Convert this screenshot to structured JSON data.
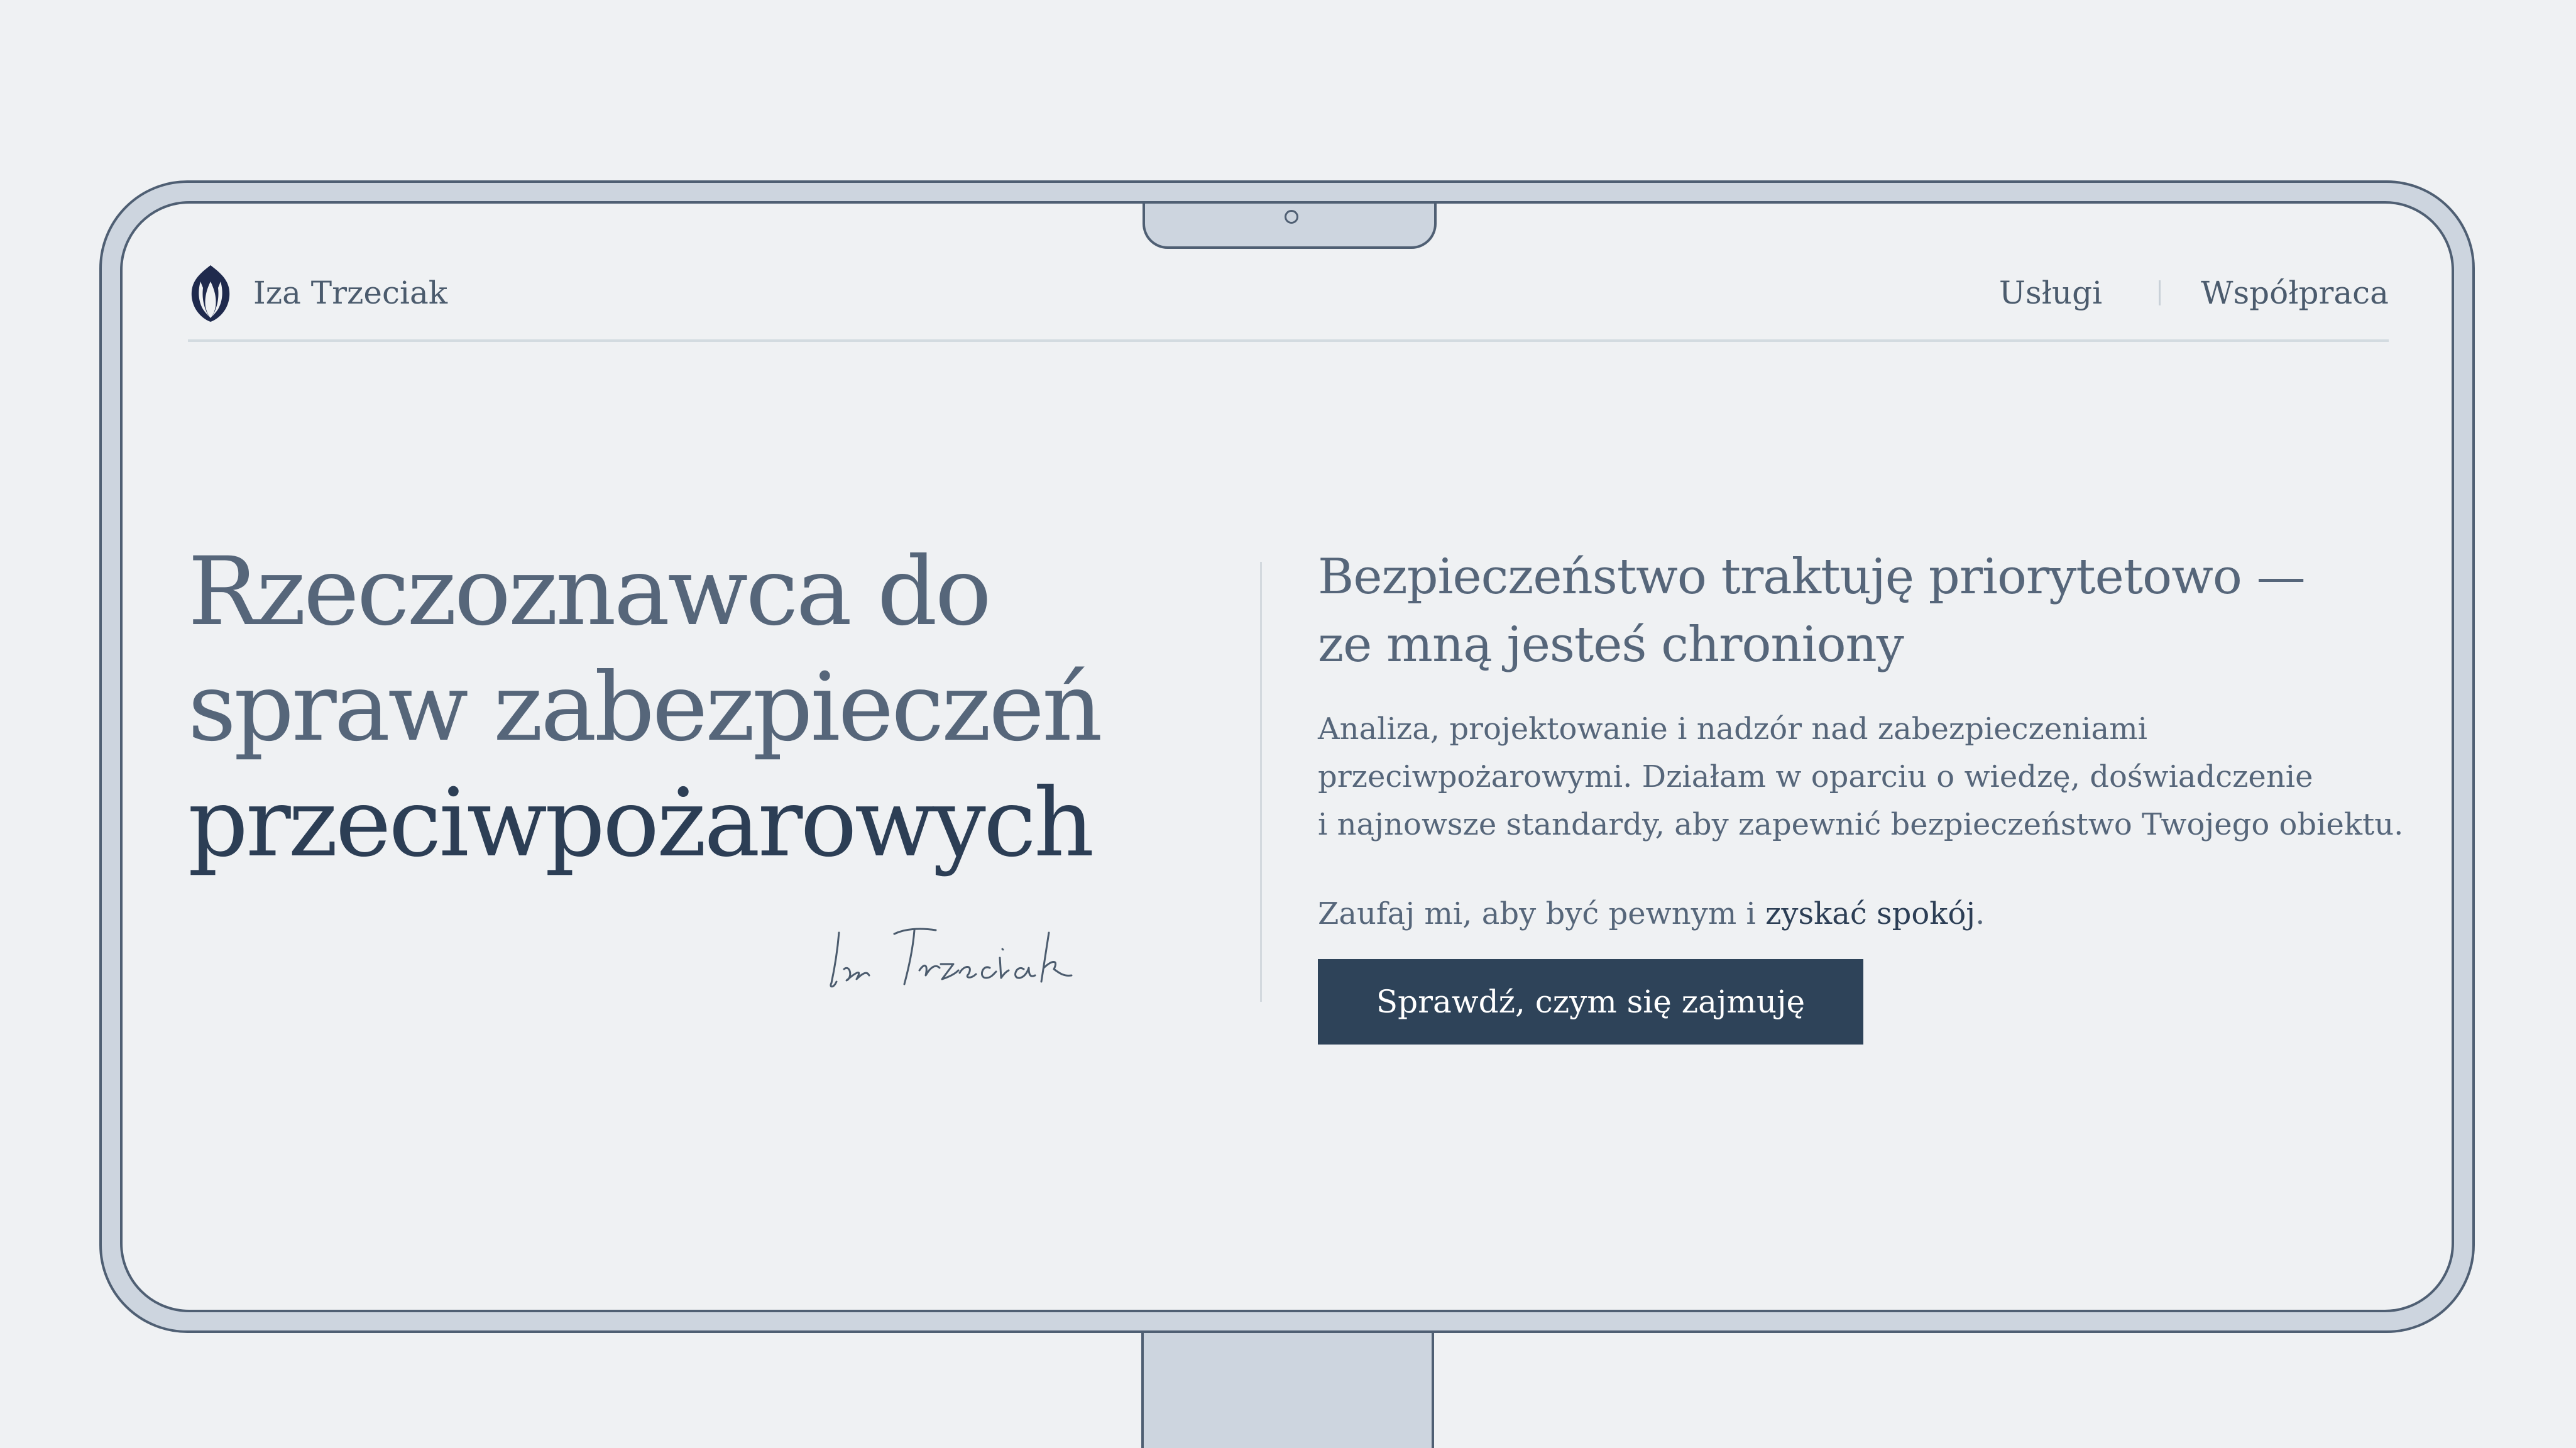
{
  "colors": {
    "background": "#eff1f3",
    "frame": "#cdd5df",
    "outline": "#4f5f73",
    "text_muted": "#56667a",
    "text_dark": "#2c3e55",
    "button": "#2e4359",
    "logo": "#1f2a4d"
  },
  "header": {
    "brand": "Iza Trzeciak",
    "logo_icon": "leaf-shield-icon",
    "nav": [
      {
        "label": "Usługi"
      },
      {
        "label": "Współpraca"
      }
    ]
  },
  "hero": {
    "headline_lines": [
      "Rzeczoznawca do",
      "spraw zabezpieczeń",
      "przeciwpożarowych"
    ],
    "signature": "Iza Trzeciak",
    "subheadline_lines": [
      "Bezpieczeństwo traktuję priorytetowo —",
      "ze mną jesteś chroniony"
    ],
    "description_lines": [
      "Analiza, projektowanie i nadzór nad zabezpieczeniami",
      "przeciwpożarowymi. Działam w oparciu o wiedzę, doświadczenie",
      "i najnowsze standardy, aby zapewnić bezpieczeństwo Twojego obiektu."
    ],
    "trust_prefix": "Zaufaj mi, aby być pewnym i ",
    "trust_highlight": "zyskać spokój",
    "trust_suffix": ".",
    "cta_label": "Sprawdź, czym się zajmuję"
  }
}
